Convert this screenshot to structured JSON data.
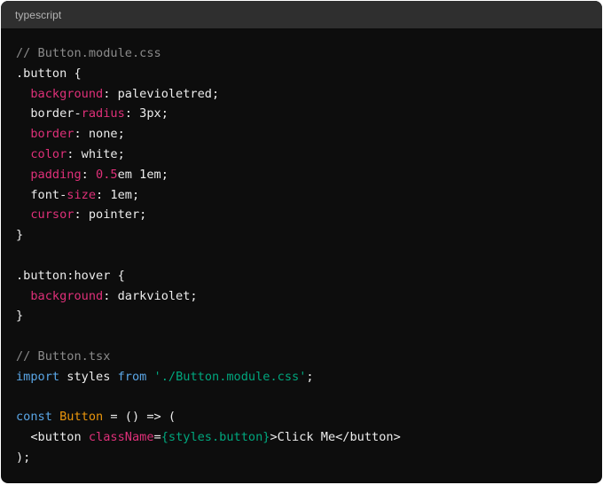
{
  "code_block": {
    "language": "typescript",
    "lines": [
      [
        {
          "t": "// Button.module.css",
          "k": "comment"
        }
      ],
      [
        {
          "t": ".button {",
          "k": "plain"
        }
      ],
      [
        {
          "t": "  ",
          "k": "plain"
        },
        {
          "t": "background",
          "k": "prop"
        },
        {
          "t": ": palevioletred;",
          "k": "plain"
        }
      ],
      [
        {
          "t": "  border-",
          "k": "plain"
        },
        {
          "t": "radius",
          "k": "prop"
        },
        {
          "t": ": 3px;",
          "k": "plain"
        }
      ],
      [
        {
          "t": "  ",
          "k": "plain"
        },
        {
          "t": "border",
          "k": "prop"
        },
        {
          "t": ": none;",
          "k": "plain"
        }
      ],
      [
        {
          "t": "  ",
          "k": "plain"
        },
        {
          "t": "color",
          "k": "prop"
        },
        {
          "t": ": white;",
          "k": "plain"
        }
      ],
      [
        {
          "t": "  ",
          "k": "plain"
        },
        {
          "t": "padding",
          "k": "prop"
        },
        {
          "t": ": ",
          "k": "plain"
        },
        {
          "t": "0.5",
          "k": "num"
        },
        {
          "t": "em 1em;",
          "k": "plain"
        }
      ],
      [
        {
          "t": "  font-",
          "k": "plain"
        },
        {
          "t": "size",
          "k": "prop"
        },
        {
          "t": ": 1em;",
          "k": "plain"
        }
      ],
      [
        {
          "t": "  ",
          "k": "plain"
        },
        {
          "t": "cursor",
          "k": "prop"
        },
        {
          "t": ": pointer;",
          "k": "plain"
        }
      ],
      [
        {
          "t": "}",
          "k": "plain"
        }
      ],
      [],
      [
        {
          "t": ".button:hover {",
          "k": "plain"
        }
      ],
      [
        {
          "t": "  ",
          "k": "plain"
        },
        {
          "t": "background",
          "k": "prop"
        },
        {
          "t": ": darkviolet;",
          "k": "plain"
        }
      ],
      [
        {
          "t": "}",
          "k": "plain"
        }
      ],
      [],
      [
        {
          "t": "// Button.tsx",
          "k": "comment"
        }
      ],
      [
        {
          "t": "import",
          "k": "keyword"
        },
        {
          "t": " styles ",
          "k": "plain"
        },
        {
          "t": "from",
          "k": "keyword"
        },
        {
          "t": " ",
          "k": "plain"
        },
        {
          "t": "'./Button.module.css'",
          "k": "string"
        },
        {
          "t": ";",
          "k": "plain"
        }
      ],
      [],
      [
        {
          "t": "const",
          "k": "keyword"
        },
        {
          "t": " ",
          "k": "plain"
        },
        {
          "t": "Button",
          "k": "class"
        },
        {
          "t": " = () => (",
          "k": "plain"
        }
      ],
      [
        {
          "t": "  <button ",
          "k": "plain"
        },
        {
          "t": "className",
          "k": "prop"
        },
        {
          "t": "=",
          "k": "plain"
        },
        {
          "t": "{styles.button}",
          "k": "string"
        },
        {
          "t": ">Click Me</button>",
          "k": "plain"
        }
      ],
      [
        {
          "t": ");",
          "k": "plain"
        }
      ]
    ]
  },
  "colors": {
    "background": "#0d0d0d",
    "header": "#2f2f2f",
    "comment": "#8b8b8b",
    "property": "#df3079",
    "keyword": "#5aa6e6",
    "string": "#00a67d",
    "class_name": "#e9950c",
    "text": "#ececec"
  }
}
